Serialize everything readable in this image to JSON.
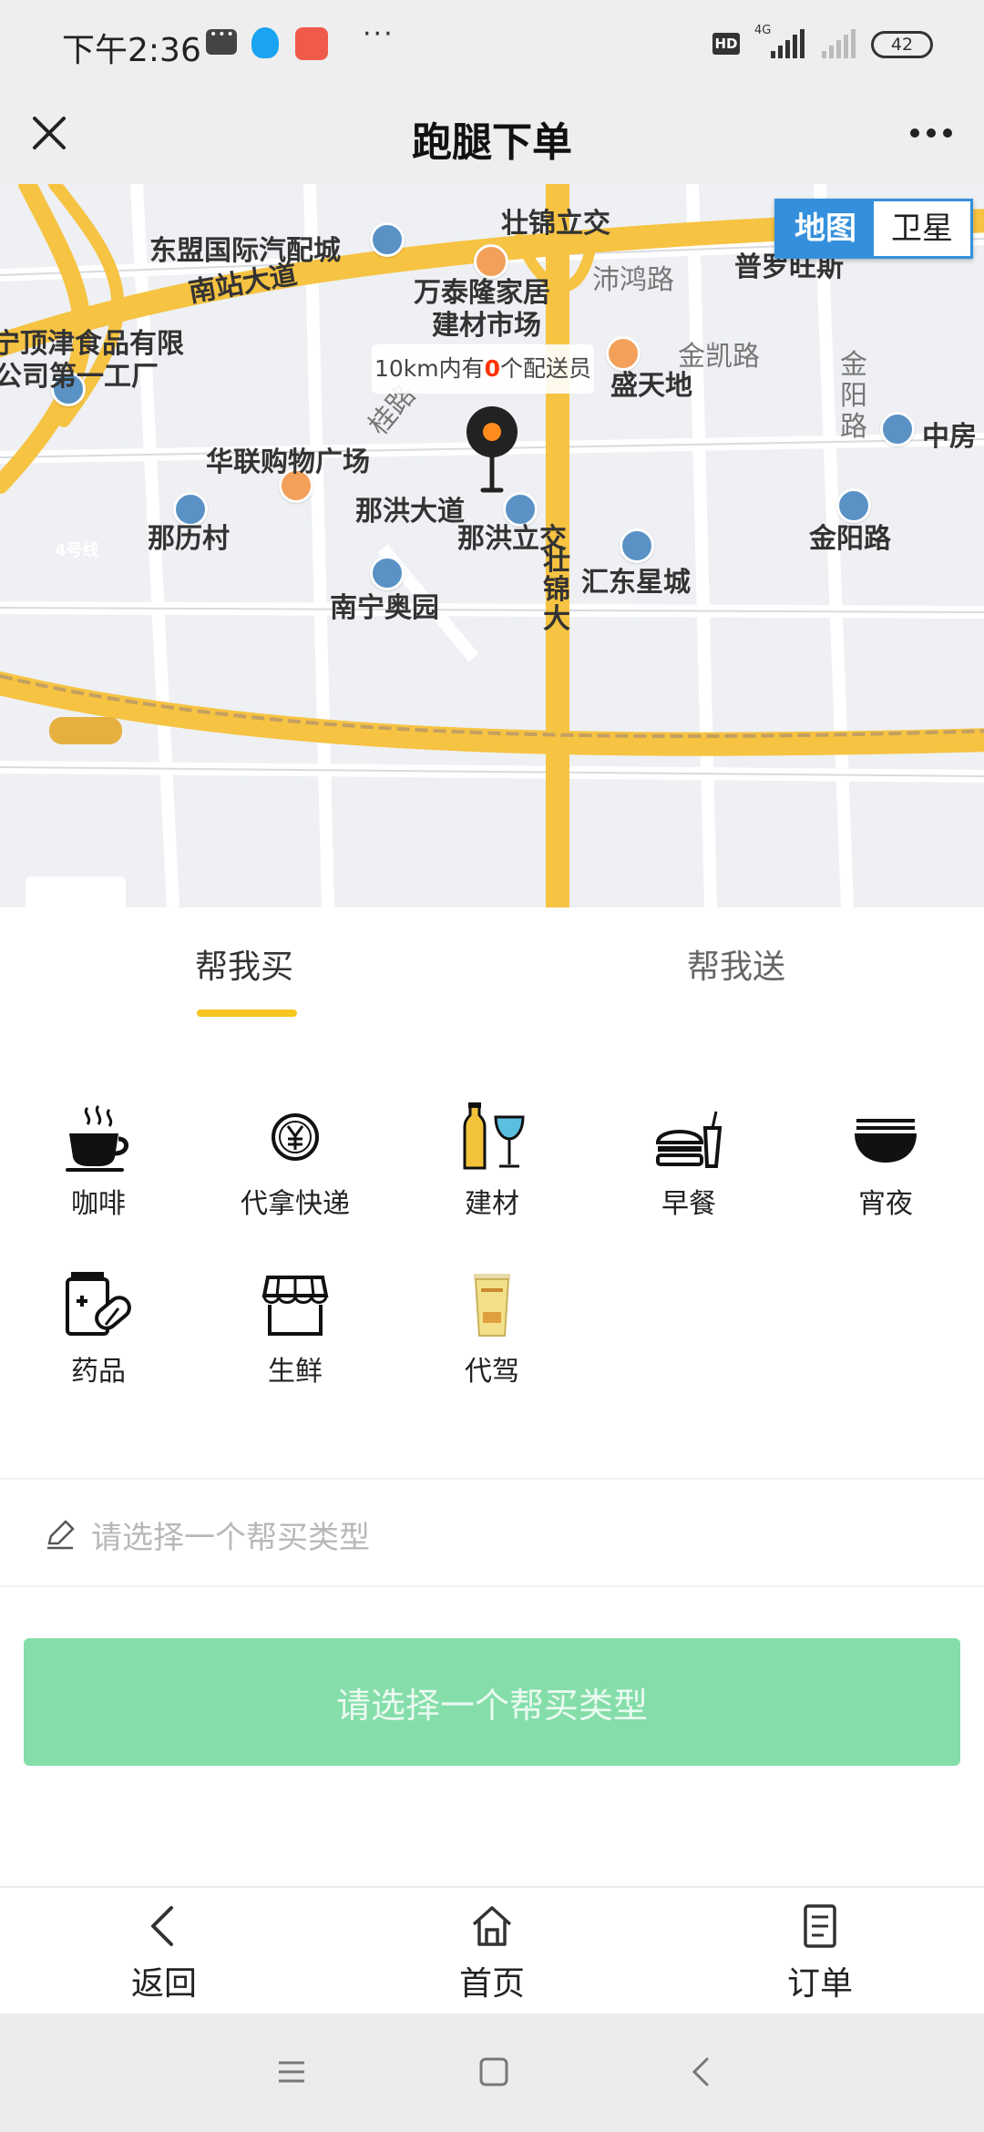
{
  "status_bar": {
    "time": "下午2:36",
    "hd": "HD",
    "network": "4G",
    "battery": "42",
    "more": "···"
  },
  "header": {
    "title": "跑腿下单"
  },
  "map": {
    "toggle": {
      "map": "地图",
      "satellite": "卫星"
    },
    "courier_prefix": "10km内有",
    "courier_count": "0",
    "courier_suffix": "个配送员",
    "labels": {
      "nanzhan": "南站大道",
      "zhuangjin_ljiao": "壮锦立交",
      "dongmeng": "东盟国际汽配城",
      "wantai1": "万泰隆家居",
      "wantai2": "建材市场",
      "peihong": "沛鸿路",
      "puluowangsi": "普罗旺斯",
      "dingjin1": "宁顶津食品有限",
      "dingjin2": "公司第一工厂",
      "jinkai": "金凯路",
      "shengtiandi": "盛天地",
      "jinyang_v": [
        "金",
        "阳",
        "路"
      ],
      "zhongfang": "中房",
      "guilu": "桂路",
      "hualian": "华联购物广场",
      "line4": "4号线",
      "nahong_road": "那洪大道",
      "nali": "那历村",
      "nahong_ljiao": "那洪立交",
      "jinyang": "金阳路",
      "huidong": "汇东星城",
      "zhuangjin_v": [
        "壮",
        "锦",
        "大"
      ],
      "nanning_ao": "南宁奥园"
    }
  },
  "tabs": [
    {
      "label": "帮我买",
      "active": true
    },
    {
      "label": "帮我送",
      "active": false
    }
  ],
  "categories": [
    {
      "label": "咖啡",
      "icon": "coffee-icon"
    },
    {
      "label": "代拿快递",
      "icon": "yuan-coin-icon"
    },
    {
      "label": "建材",
      "icon": "drinks-icon"
    },
    {
      "label": "早餐",
      "icon": "burger-icon"
    },
    {
      "label": "宵夜",
      "icon": "noodle-bowl-icon"
    },
    {
      "label": "药品",
      "icon": "medicine-icon"
    },
    {
      "label": "生鲜",
      "icon": "store-icon"
    },
    {
      "label": "代驾",
      "icon": "milk-tea-icon"
    }
  ],
  "remark": {
    "placeholder": "请选择一个帮买类型"
  },
  "submit": {
    "label": "请选择一个帮买类型"
  },
  "bottom_nav": [
    {
      "label": "返回",
      "icon": "back-icon"
    },
    {
      "label": "首页",
      "icon": "home-icon"
    },
    {
      "label": "订单",
      "icon": "order-icon"
    }
  ],
  "colors": {
    "accent_yellow": "#f7c620",
    "submit_green": "#85deaa",
    "map_toggle_blue": "#3490dc",
    "road_yellow": "#f6c342"
  }
}
